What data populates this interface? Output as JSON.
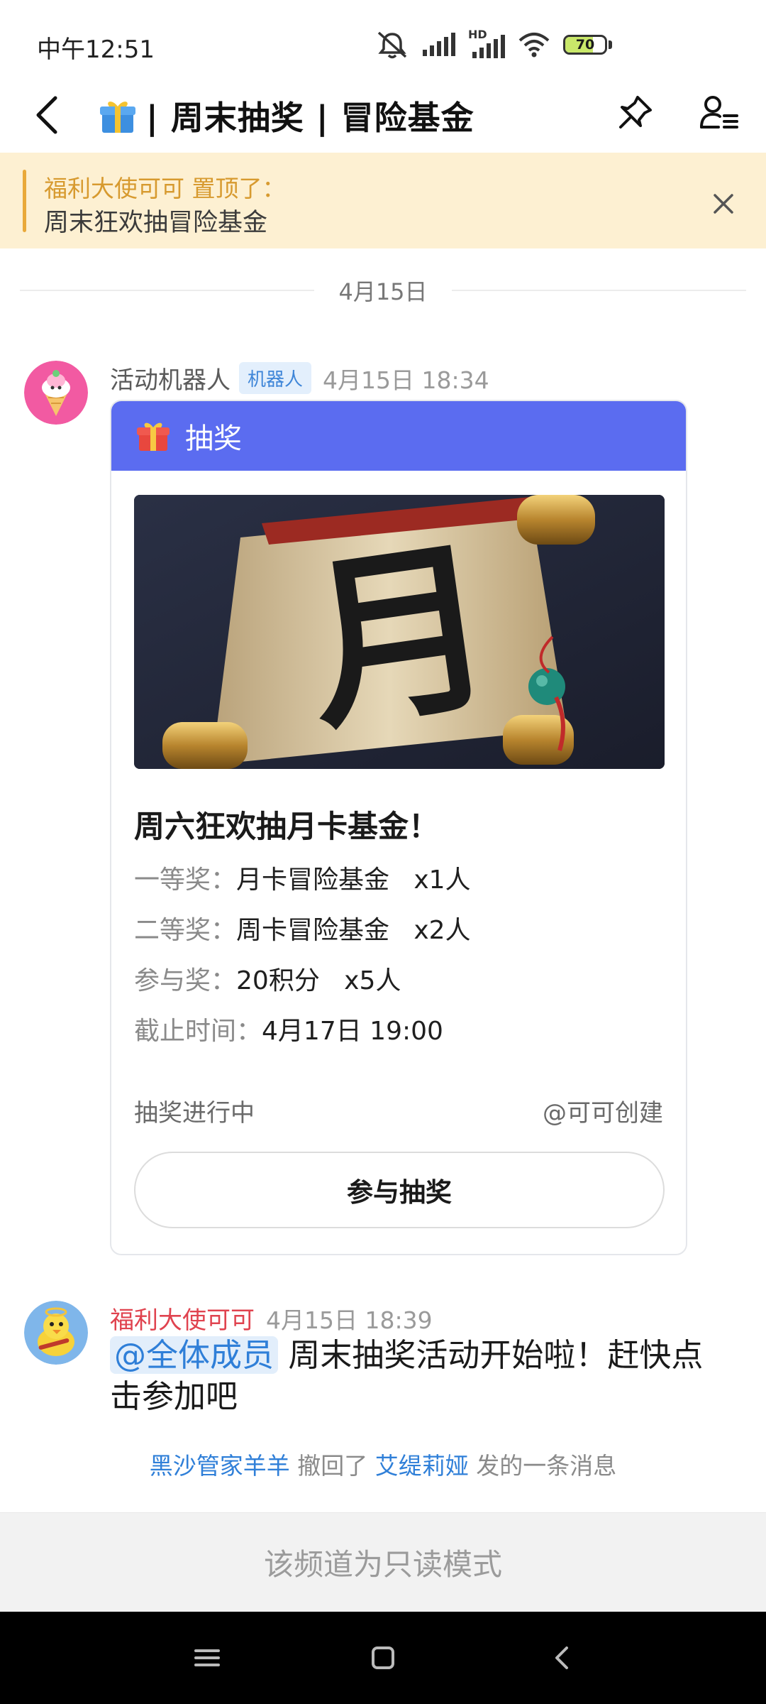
{
  "status_bar": {
    "time": "中午12:51",
    "battery": "70",
    "battery_level": 0.7,
    "signal_label": "HD",
    "icons": [
      "mute-icon",
      "signal-icon",
      "signal-hd-icon",
      "wifi-icon",
      "battery-icon"
    ]
  },
  "header": {
    "title": "| 周末抽奖 | 冒险基金",
    "title_icon": "gift-icon",
    "back_icon": "back-arrow-icon",
    "pin_icon": "pin-icon",
    "members_icon": "member-list-icon"
  },
  "pinned": {
    "line1": "福利大使可可 置顶了：",
    "line2": "周末狂欢抽冒险基金"
  },
  "date_divider": "4月15日",
  "messages": [
    {
      "sender": "活动机器人",
      "badge": "机器人",
      "time": "4月15日 18:34",
      "card": {
        "header_title": "抽奖",
        "title": "周六狂欢抽月卡基金！",
        "image_character": "月",
        "prizes": [
          {
            "label": "一等奖：",
            "value": "月卡冒险基金   x1人"
          },
          {
            "label": "二等奖：",
            "value": "周卡冒险基金   x2人"
          },
          {
            "label": "参与奖：",
            "value": "20积分   x5人"
          },
          {
            "label": "截止时间：",
            "value": "4月17日 19:00"
          }
        ],
        "status": "抽奖进行中",
        "creator": "@可可创建",
        "button": "参与抽奖"
      }
    },
    {
      "sender": "福利大使可可",
      "time": "4月15日 18:39",
      "mention": "@全体成员",
      "text": " 周末抽奖活动开始啦！赶快点击参加吧"
    }
  ],
  "recall": {
    "actor": "黑沙管家羊羊",
    "middle": " 撤回了 ",
    "target": "艾缇莉娅",
    "suffix": " 发的一条消息"
  },
  "readonly_text": "该频道为只读模式",
  "colors": {
    "card_header": "#5b6cf0",
    "pinned_bg": "#fdf0d2",
    "pinned_accent": "#e9a93a",
    "mention": "#2f7fd8",
    "sender_red": "#e0434f"
  }
}
